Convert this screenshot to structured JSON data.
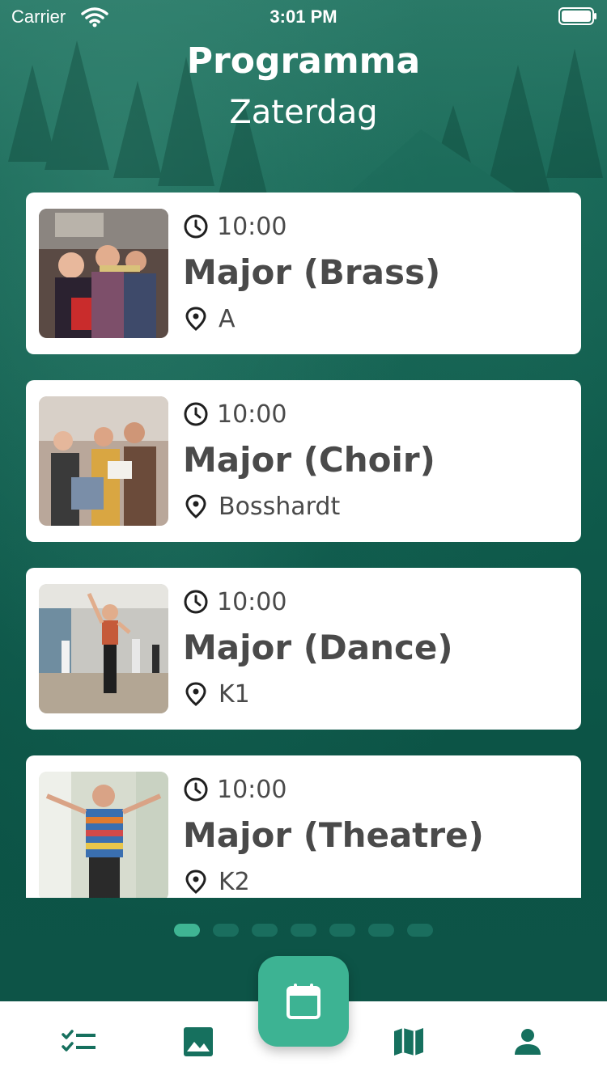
{
  "status_bar": {
    "carrier": "Carrier",
    "time": "3:01 PM"
  },
  "header": {
    "title": "Programma",
    "subtitle": "Zaterdag"
  },
  "events": [
    {
      "time": "10:00",
      "name": "Major (Brass)",
      "location": "A"
    },
    {
      "time": "10:00",
      "name": "Major (Choir)",
      "location": "Bosshardt"
    },
    {
      "time": "10:00",
      "name": "Major (Dance)",
      "location": "K1"
    },
    {
      "time": "10:00",
      "name": "Major (Theatre)",
      "location": "K2"
    }
  ],
  "pager": {
    "count": 7,
    "active_index": 0
  },
  "tabbar": {
    "items": [
      "checklist-icon",
      "image-icon",
      "calendar-icon",
      "map-icon",
      "person-icon"
    ],
    "active": "calendar-icon"
  },
  "colors": {
    "accent": "#3db393",
    "tab_icon": "#16705e",
    "text": "#4a4a4a",
    "background": "#0f5a4a"
  }
}
